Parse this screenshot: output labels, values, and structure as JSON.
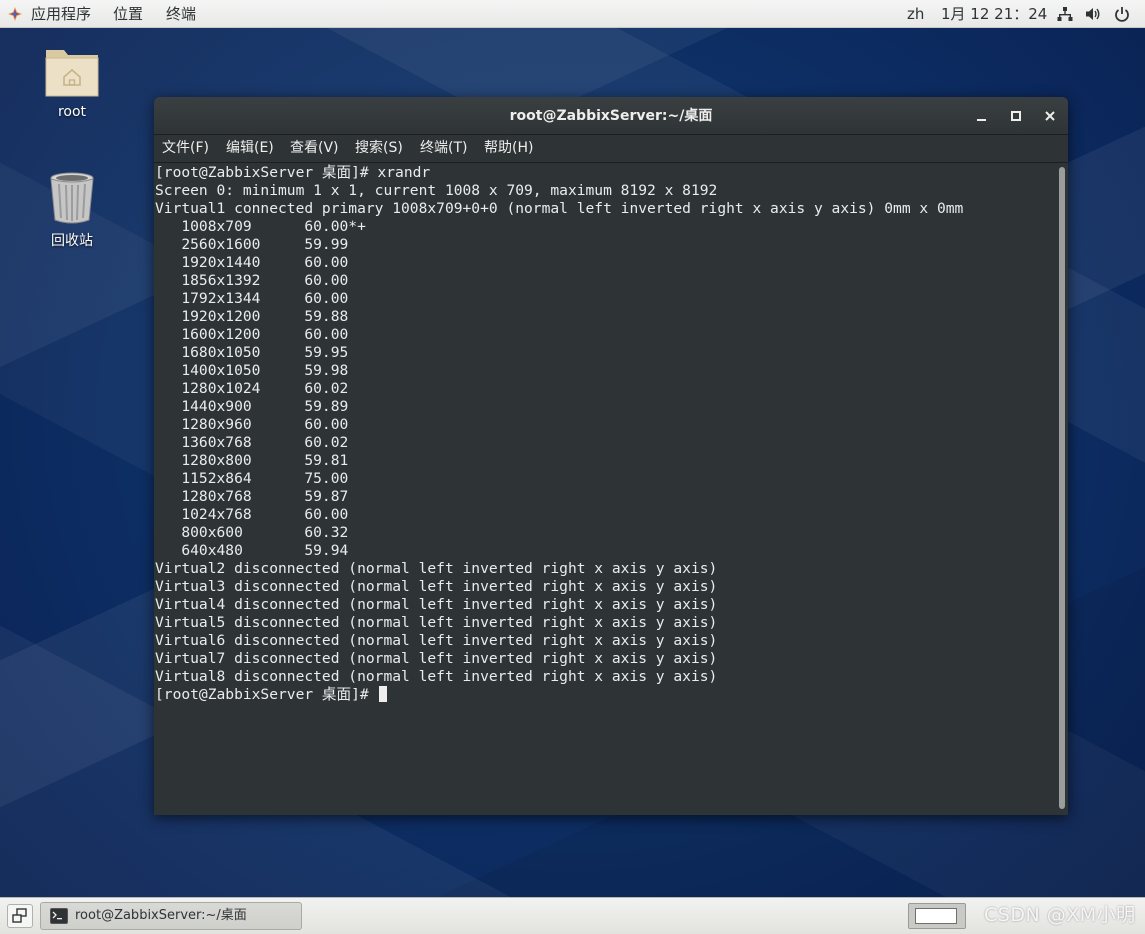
{
  "topbar": {
    "applications": "应用程序",
    "places": "位置",
    "terminal": "终端",
    "language": "zh",
    "clock": "1月 12  21：24"
  },
  "desktop": {
    "icons": [
      {
        "label": "root",
        "icon": "home-folder-icon"
      },
      {
        "label": "回收站",
        "icon": "trash-icon"
      }
    ]
  },
  "window": {
    "title": "root@ZabbixServer:~/桌面",
    "menu": [
      "文件(F)",
      "编辑(E)",
      "查看(V)",
      "搜索(S)",
      "终端(T)",
      "帮助(H)"
    ]
  },
  "terminal": {
    "lines": [
      "[root@ZabbixServer 桌面]# xrandr",
      "Screen 0: minimum 1 x 1, current 1008 x 709, maximum 8192 x 8192",
      "Virtual1 connected primary 1008x709+0+0 (normal left inverted right x axis y axis) 0mm x 0mm",
      "   1008x709      60.00*+",
      "   2560x1600     59.99",
      "   1920x1440     60.00",
      "   1856x1392     60.00",
      "   1792x1344     60.00",
      "   1920x1200     59.88",
      "   1600x1200     60.00",
      "   1680x1050     59.95",
      "   1400x1050     59.98",
      "   1280x1024     60.02",
      "   1440x900      59.89",
      "   1280x960      60.00",
      "   1360x768      60.02",
      "   1280x800      59.81",
      "   1152x864      75.00",
      "   1280x768      59.87",
      "   1024x768      60.00",
      "   800x600       60.32",
      "   640x480       59.94",
      "Virtual2 disconnected (normal left inverted right x axis y axis)",
      "Virtual3 disconnected (normal left inverted right x axis y axis)",
      "Virtual4 disconnected (normal left inverted right x axis y axis)",
      "Virtual5 disconnected (normal left inverted right x axis y axis)",
      "Virtual6 disconnected (normal left inverted right x axis y axis)",
      "Virtual7 disconnected (normal left inverted right x axis y axis)",
      "Virtual8 disconnected (normal left inverted right x axis y axis)"
    ],
    "prompt": "[root@ZabbixServer 桌面]# "
  },
  "taskbar": {
    "task_label": "root@ZabbixServer:~/桌面",
    "watermark": "CSDN @XM小明"
  },
  "colors": {
    "terminal_bg": "#2e3436",
    "terminal_fg": "#e9ecec",
    "desktop_bg": "#0e3167"
  }
}
